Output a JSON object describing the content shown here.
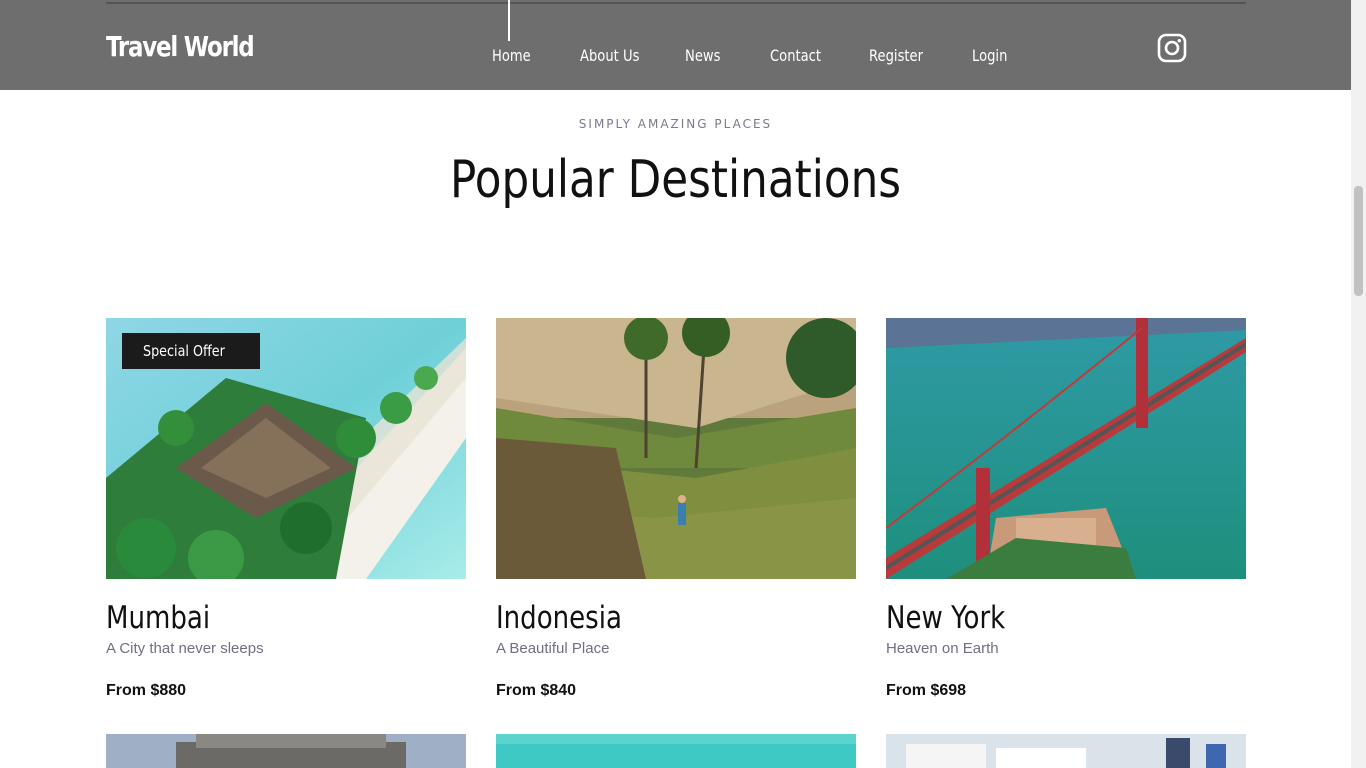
{
  "header": {
    "logo": "Travel World",
    "nav": [
      "Home",
      "About Us",
      "News",
      "Contact",
      "Register",
      "Login"
    ],
    "active": "Home",
    "social_icon": "instagram-icon"
  },
  "section": {
    "eyebrow": "SIMPLY AMAZING PLACES",
    "title": "Popular Destinations"
  },
  "destinations": [
    {
      "name": "Mumbai",
      "tagline": "A City that never sleeps",
      "price": "From $880",
      "badge": "Special Offer"
    },
    {
      "name": "Indonesia",
      "tagline": "A Beautiful Place",
      "price": "From $840"
    },
    {
      "name": "New York",
      "tagline": "Heaven on Earth",
      "price": "From $698"
    }
  ],
  "colors": {
    "header_bg": "#6e6e6e",
    "badge_bg": "#1b1b1b",
    "subtitle": "#6f6f86"
  }
}
